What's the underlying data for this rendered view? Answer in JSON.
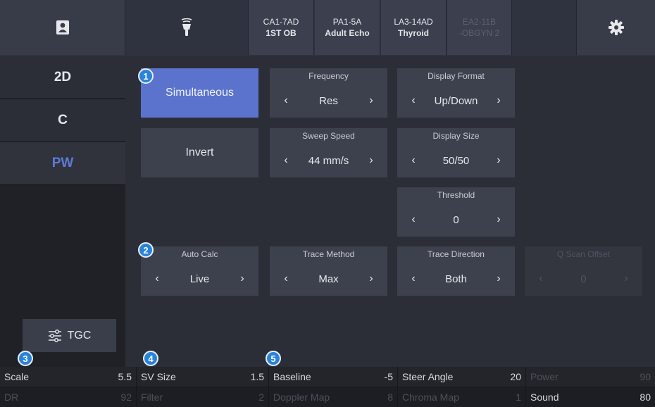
{
  "topbar": {
    "patient_icon": "patient-id-icon",
    "probe_icon": "probe-icon",
    "settings_icon": "gear-icon",
    "probe_tabs": [
      {
        "model": "CA1-7AD",
        "preset": "1ST OB",
        "enabled": true
      },
      {
        "model": "PA1-5A",
        "preset": "Adult Echo",
        "enabled": true
      },
      {
        "model": "LA3-14AD",
        "preset": "Thyroid",
        "enabled": true
      },
      {
        "model": "EA2-11B",
        "preset": "-OBGYN 2",
        "enabled": false
      }
    ]
  },
  "modes": {
    "items": [
      "2D",
      "C",
      "PW"
    ],
    "active": "PW",
    "tgc_label": "TGC",
    "tgc_icon": "sliders-icon"
  },
  "main": {
    "simultaneous_label": "Simultaneous",
    "invert_label": "Invert",
    "frequency": {
      "caption": "Frequency",
      "value": "Res"
    },
    "display_format": {
      "caption": "Display Format",
      "value": "Up/Down"
    },
    "sweep_speed": {
      "caption": "Sweep Speed",
      "value": "44 mm/s"
    },
    "display_size": {
      "caption": "Display Size",
      "value": "50/50"
    },
    "threshold": {
      "caption": "Threshold",
      "value": "0"
    },
    "auto_calc": {
      "caption": "Auto Calc",
      "value": "Live"
    },
    "trace_method": {
      "caption": "Trace Method",
      "value": "Max"
    },
    "trace_direction": {
      "caption": "Trace Direction",
      "value": "Both"
    },
    "q_scan_offset": {
      "caption": "Q Scan Offset",
      "value": "0"
    },
    "arrow_left": "‹",
    "arrow_right": "›"
  },
  "badges": [
    "1",
    "2",
    "3",
    "4",
    "5"
  ],
  "bottom": {
    "row1": [
      {
        "label": "Scale",
        "value": "5.5",
        "enabled": true
      },
      {
        "label": "SV Size",
        "value": "1.5",
        "enabled": true
      },
      {
        "label": "Baseline",
        "value": "-5",
        "enabled": true
      },
      {
        "label": "Steer Angle",
        "value": "20",
        "enabled": true
      },
      {
        "label": "Power",
        "value": "90",
        "enabled": false
      }
    ],
    "row2": [
      {
        "label": "DR",
        "value": "92",
        "enabled": false
      },
      {
        "label": "Filter",
        "value": "2",
        "enabled": false
      },
      {
        "label": "Doppler Map",
        "value": "8",
        "enabled": false
      },
      {
        "label": "Chroma Map",
        "value": "1",
        "enabled": false
      },
      {
        "label": "Sound",
        "value": "80",
        "enabled": true
      }
    ]
  },
  "colors": {
    "accent": "#5b73cc",
    "active_mode": "#5f79d8",
    "badge": "#2a83d9"
  }
}
